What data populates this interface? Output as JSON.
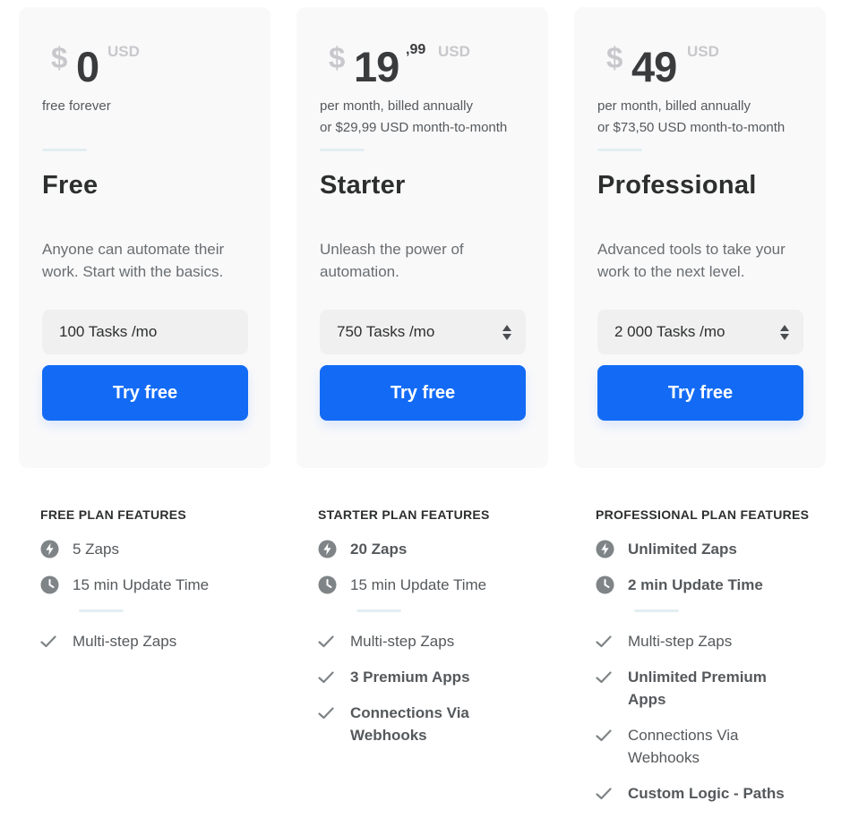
{
  "plans": [
    {
      "currency_symbol": "$",
      "amount": "0",
      "cents": "",
      "currency": "USD",
      "billing_line1": "free forever",
      "billing_line2": "",
      "name": "Free",
      "description": "Anyone can automate their work. Start with the basics.",
      "tasks": "100 Tasks /mo",
      "has_spinner": false,
      "cta": "Try free",
      "features_title": "FREE PLAN FEATURES",
      "features": [
        {
          "icon": "lightning-icon",
          "text": "5 Zaps",
          "bold": false
        },
        {
          "icon": "clock-icon",
          "text": "15 min Update Time",
          "bold": false
        }
      ],
      "extras": [
        {
          "icon": "check-icon",
          "text": "Multi-step Zaps",
          "bold": false
        }
      ]
    },
    {
      "currency_symbol": "$",
      "amount": "19",
      "cents": ",99",
      "currency": "USD",
      "billing_line1": "per month, billed annually",
      "billing_line2": "or $29,99 USD month-to-month",
      "name": "Starter",
      "description": "Unleash the power of automation.",
      "tasks": "750 Tasks /mo",
      "has_spinner": true,
      "cta": "Try free",
      "features_title": "STARTER PLAN FEATURES",
      "features": [
        {
          "icon": "lightning-icon",
          "text": "20 Zaps",
          "bold": true
        },
        {
          "icon": "clock-icon",
          "text": "15 min Update Time",
          "bold": false
        }
      ],
      "extras": [
        {
          "icon": "check-icon",
          "text": "Multi-step Zaps",
          "bold": false
        },
        {
          "icon": "check-icon",
          "text": "3 Premium Apps",
          "bold": true
        },
        {
          "icon": "check-icon",
          "text": "Connections Via Webhooks",
          "bold": true
        }
      ]
    },
    {
      "currency_symbol": "$",
      "amount": "49",
      "cents": "",
      "currency": "USD",
      "billing_line1": "per month, billed annually",
      "billing_line2": "or $73,50 USD month-to-month",
      "name": "Professional",
      "description": "Advanced tools to take your work to the next level.",
      "tasks": "2 000 Tasks /mo",
      "has_spinner": true,
      "cta": "Try free",
      "features_title": "PROFESSIONAL PLAN FEATURES",
      "features": [
        {
          "icon": "lightning-icon",
          "text": "Unlimited Zaps",
          "bold": true
        },
        {
          "icon": "clock-icon",
          "text": "2 min Update Time",
          "bold": true
        }
      ],
      "extras": [
        {
          "icon": "check-icon",
          "text": "Multi-step Zaps",
          "bold": false
        },
        {
          "icon": "check-icon",
          "text": "Unlimited Premium Apps",
          "bold": true
        },
        {
          "icon": "check-icon",
          "text": "Connections Via Webhooks",
          "bold": false
        },
        {
          "icon": "check-icon",
          "text": "Custom Logic - Paths",
          "bold": true
        }
      ]
    }
  ],
  "colors": {
    "primary": "#136bf5",
    "card_bg": "#f9f9fa",
    "icon_gray": "#7f8487"
  }
}
